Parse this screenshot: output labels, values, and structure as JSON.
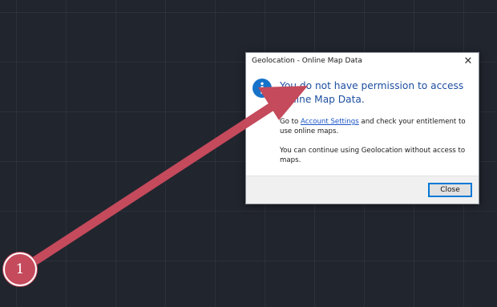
{
  "dialog": {
    "title": "Geolocation - Online Map Data",
    "close_glyph": "✕",
    "icon": "info-icon",
    "heading": "You do not have permission to access Online Map Data.",
    "paragraph1_before": "Go to ",
    "paragraph1_link": "Account Settings",
    "paragraph1_after": " and check your entitlement to use online maps.",
    "paragraph2": "You can continue using Geolocation without access to maps.",
    "close_button_label": "Close"
  },
  "annotation": {
    "step_number": "1",
    "color": "#c44a5c"
  },
  "colors": {
    "background": "#21252e",
    "heading": "#1e4fa0",
    "link": "#1a55c8",
    "info_icon": "#1673c9"
  }
}
